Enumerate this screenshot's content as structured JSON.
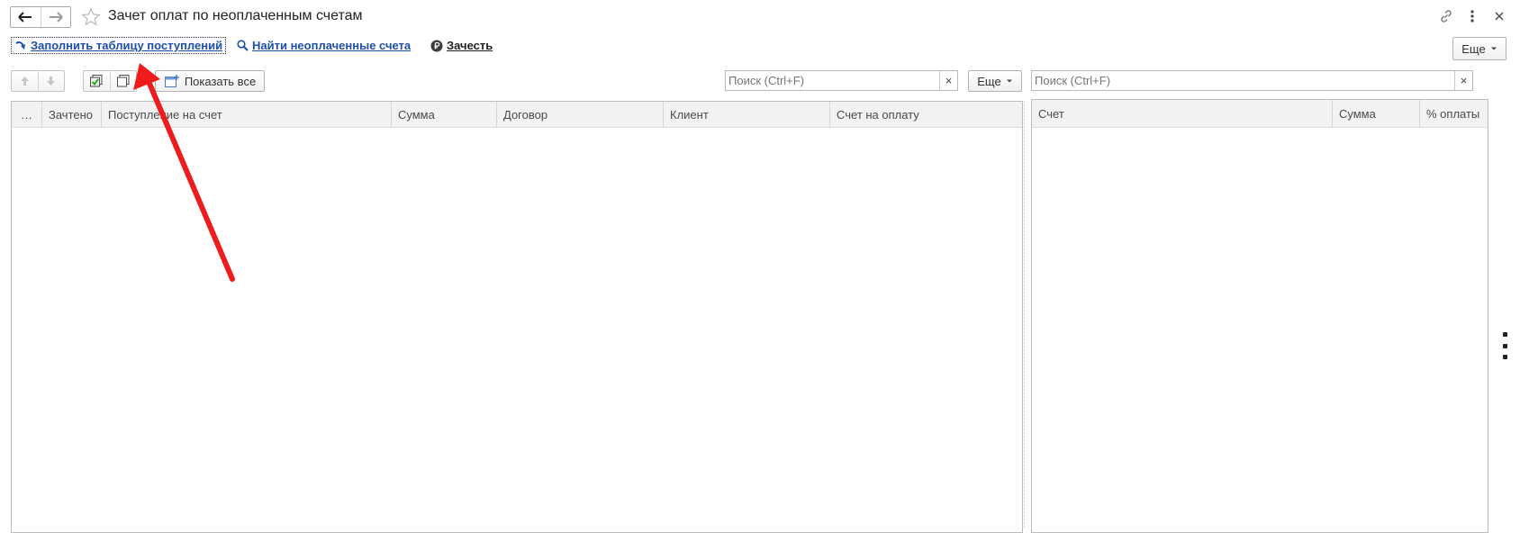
{
  "window": {
    "title": "Зачет оплат по неоплаченным счетам"
  },
  "commands": {
    "fill_table": "Заполнить таблицу поступлений",
    "find_unpaid": "Найти неоплаченные счета",
    "apply": "Зачесть",
    "more": "Еще"
  },
  "left_panel": {
    "show_all": "Показать все",
    "search": {
      "placeholder": "Поиск (Ctrl+F)",
      "clear": "×"
    },
    "more": "Еще",
    "columns": [
      "…",
      "Зачтено",
      "Поступление на счет",
      "Сумма",
      "Договор",
      "Клиент",
      "Счет на оплату"
    ],
    "rows": []
  },
  "right_panel": {
    "search": {
      "placeholder": "Поиск (Ctrl+F)",
      "clear": "×"
    },
    "columns": [
      "Счет",
      "Сумма",
      "% оплаты"
    ],
    "rows": []
  },
  "annotation": {
    "arrow_color": "#ee1c1c"
  },
  "colors": {
    "link": "#1f4fa8",
    "header_bg": "#f2f2f2",
    "border": "#bdbdbd"
  }
}
